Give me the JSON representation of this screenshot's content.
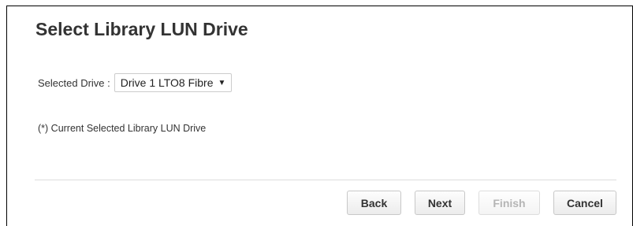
{
  "dialog": {
    "title": "Select Library LUN Drive"
  },
  "selected_drive": {
    "label": "Selected Drive :",
    "value": "Drive 1 LTO8 Fibre",
    "caret": "▼"
  },
  "note": "(*) Current Selected Library LUN Drive",
  "buttons": {
    "back": "Back",
    "next": "Next",
    "finish": "Finish",
    "cancel": "Cancel"
  }
}
